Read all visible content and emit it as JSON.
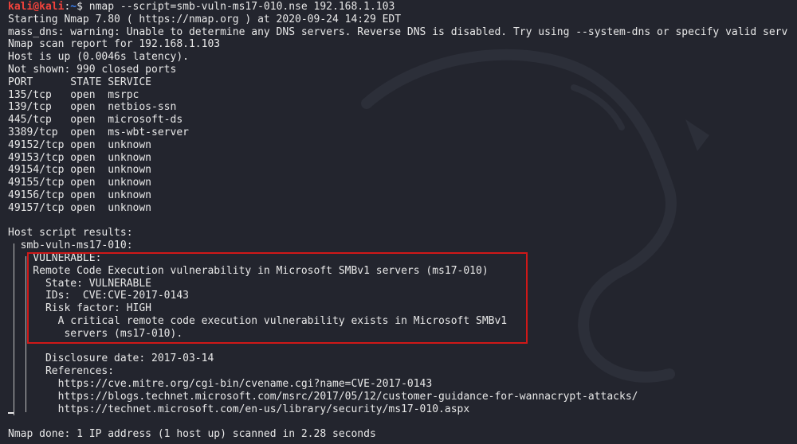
{
  "prompt": {
    "user": "kali@kali",
    "sep": ":",
    "path": "~",
    "dollar": "$ ",
    "command": "nmap --script=smb-vuln-ms17-010.nse 192.168.1.103"
  },
  "output": [
    "Starting Nmap 7.80 ( https://nmap.org ) at 2020-09-24 14:29 EDT",
    "mass_dns: warning: Unable to determine any DNS servers. Reverse DNS is disabled. Try using --system-dns or specify valid serv",
    "Nmap scan report for 192.168.1.103",
    "Host is up (0.0046s latency).",
    "Not shown: 990 closed ports",
    "PORT      STATE SERVICE",
    "135/tcp   open  msrpc",
    "139/tcp   open  netbios-ssn",
    "445/tcp   open  microsoft-ds",
    "3389/tcp  open  ms-wbt-server",
    "49152/tcp open  unknown",
    "49153/tcp open  unknown",
    "49154/tcp open  unknown",
    "49155/tcp open  unknown",
    "49156/tcp open  unknown",
    "49157/tcp open  unknown",
    "",
    "Host script results:",
    "  smb-vuln-ms17-010:",
    "    VULNERABLE:",
    "    Remote Code Execution vulnerability in Microsoft SMBv1 servers (ms17-010)",
    "      State: VULNERABLE",
    "      IDs:  CVE:CVE-2017-0143",
    "      Risk factor: HIGH",
    "        A critical remote code execution vulnerability exists in Microsoft SMBv1",
    "         servers (ms17-010).",
    "",
    "      Disclosure date: 2017-03-14",
    "      References:",
    "        https://cve.mitre.org/cgi-bin/cvename.cgi?name=CVE-2017-0143",
    "        https://blogs.technet.microsoft.com/msrc/2017/05/12/customer-guidance-for-wannacrypt-attacks/",
    "        https://technet.microsoft.com/en-us/library/security/ms17-010.aspx",
    "",
    "Nmap done: 1 IP address (1 host up) scanned in 2.28 seconds"
  ],
  "colors": {
    "background": "#23252e",
    "text": "#e8e8e8",
    "prompt_user": "#f2433c",
    "prompt_path": "#3b82f6",
    "highlight": "#d01818"
  },
  "icons": {
    "watermark": "kali-dragon-icon"
  }
}
